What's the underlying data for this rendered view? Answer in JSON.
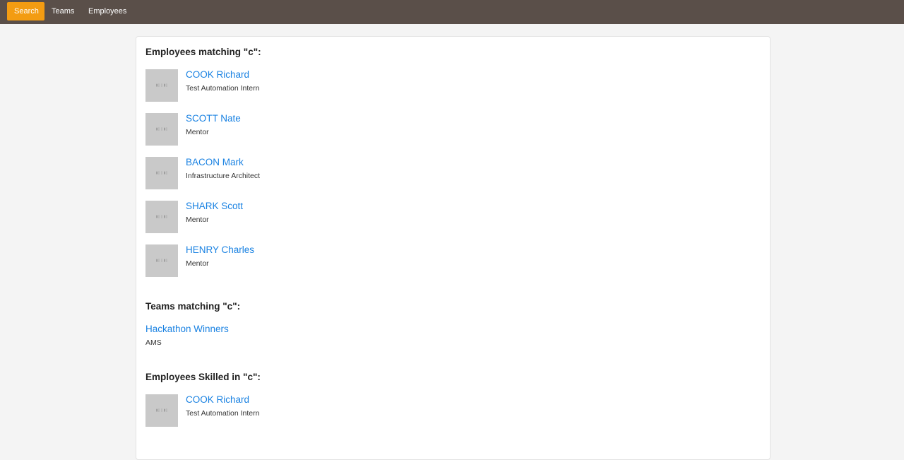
{
  "nav": {
    "items": [
      {
        "label": "Search",
        "active": true
      },
      {
        "label": "Teams",
        "active": false
      },
      {
        "label": "Employees",
        "active": false
      }
    ],
    "accent_color": "#f39c12",
    "bar_color": "#5a4f49"
  },
  "placeholder_glyph": "▮▯ ▯ ▮▯",
  "employees_section": {
    "title": "Employees matching \"c\":",
    "items": [
      {
        "name": "COOK Richard",
        "role": "Test Automation Intern",
        "avatar_icon": "image-placeholder-icon"
      },
      {
        "name": "SCOTT Nate",
        "role": "Mentor",
        "avatar_icon": "image-placeholder-icon"
      },
      {
        "name": "BACON Mark",
        "role": "Infrastructure Architect",
        "avatar_icon": "image-placeholder-icon"
      },
      {
        "name": "SHARK Scott",
        "role": "Mentor",
        "avatar_icon": "image-placeholder-icon"
      },
      {
        "name": "HENRY Charles",
        "role": "Mentor",
        "avatar_icon": "image-placeholder-icon"
      }
    ]
  },
  "teams_section": {
    "title": "Teams matching \"c\":",
    "items": [
      {
        "name": "Hackathon Winners",
        "location": "AMS"
      }
    ]
  },
  "skills_section": {
    "title": "Employees Skilled in \"c\":",
    "items": [
      {
        "name": "COOK Richard",
        "role": "Test Automation Intern",
        "avatar_icon": "image-placeholder-icon"
      }
    ]
  },
  "link_color": "#1a82e2"
}
